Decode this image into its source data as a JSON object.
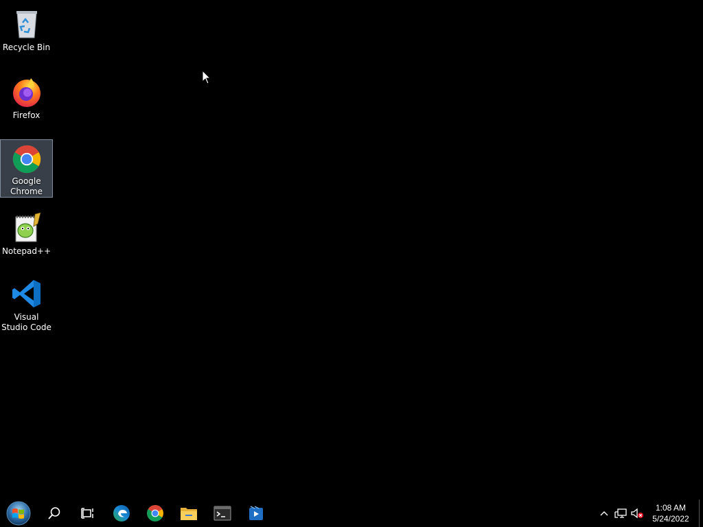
{
  "desktop": {
    "icons": [
      {
        "label": "Recycle Bin",
        "icon": "recycle-bin-icon"
      },
      {
        "label": "Firefox",
        "icon": "firefox-icon"
      },
      {
        "label": "Google Chrome",
        "icon": "chrome-icon",
        "selected": true
      },
      {
        "label": "Notepad++",
        "icon": "notepad-plus-plus-icon"
      },
      {
        "label": "Visual Studio Code",
        "icon": "vscode-icon"
      }
    ]
  },
  "taskbar": {
    "buttons": [
      {
        "name": "start-button",
        "icon": "windows-start-orb-icon"
      },
      {
        "name": "search-button",
        "icon": "search-icon"
      },
      {
        "name": "task-view-button",
        "icon": "task-view-icon"
      },
      {
        "name": "edge-button",
        "icon": "edge-icon"
      },
      {
        "name": "chrome-button",
        "icon": "chrome-icon"
      },
      {
        "name": "file-explorer-button",
        "icon": "folder-icon"
      },
      {
        "name": "terminal-button",
        "icon": "terminal-icon"
      },
      {
        "name": "media-player-button",
        "icon": "media-player-icon"
      }
    ],
    "tray": {
      "icons": [
        "chevron-up-icon",
        "network-icon",
        "volume-muted-icon"
      ],
      "time": "1:08 AM",
      "date": "5/24/2022"
    }
  },
  "colors": {
    "background": "#000000",
    "selection": "#a0b4cd"
  }
}
